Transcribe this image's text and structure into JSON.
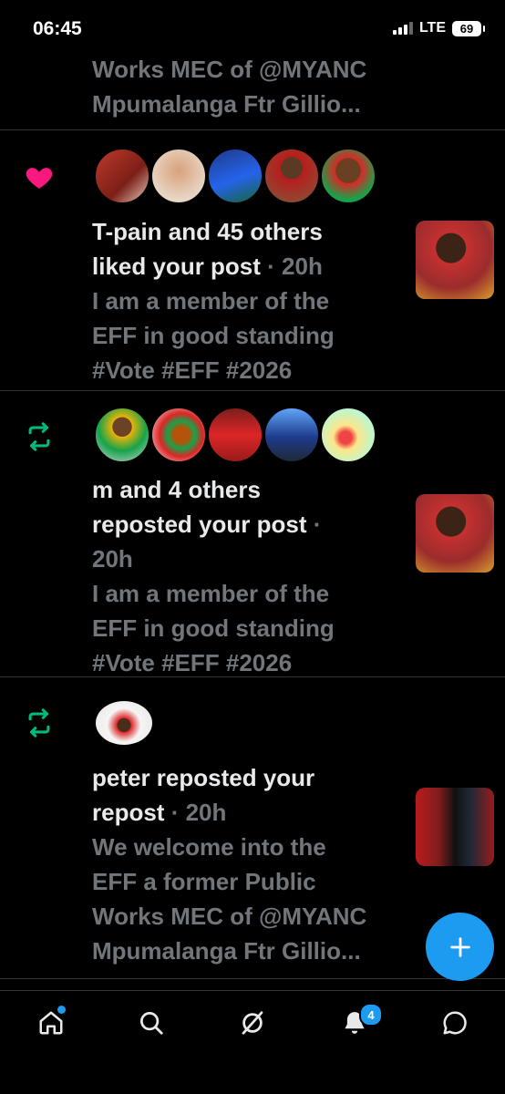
{
  "status_bar": {
    "time": "06:45",
    "network": "LTE",
    "battery": "69"
  },
  "notifications": [
    {
      "type": "partial",
      "lines": [
        "Works MEC of @MYANC",
        "Mpumalanga Ftr Gillio..."
      ]
    },
    {
      "type": "like",
      "icon": "heart-icon",
      "title_line1": "T-pain and 45 others",
      "title_line2": "liked your post",
      "time": "· 20h",
      "post_lines": [
        "I am a member of the",
        "EFF in good standing",
        "#Vote #EFF #2026"
      ]
    },
    {
      "type": "repost",
      "icon": "repost-icon",
      "title_line1": "m and 4 others",
      "title_line2": "reposted your post",
      "time_sep": "·",
      "time": "20h",
      "post_lines": [
        "I am a member of the",
        "EFF in good standing",
        "#Vote #EFF #2026"
      ]
    },
    {
      "type": "repost",
      "icon": "repost-icon",
      "title_line1": "peter reposted your",
      "title_line2": "repost",
      "time": "· 20h",
      "post_lines": [
        "We welcome into the",
        "EFF a former Public",
        "Works MEC of @MYANC",
        "Mpumalanga Ftr Gillio..."
      ]
    }
  ],
  "bottom_nav": {
    "items": [
      "home-icon",
      "search-icon",
      "grok-icon",
      "notifications-icon",
      "messages-icon"
    ],
    "notifications_badge": "4"
  },
  "colors": {
    "accent": "#1d9bf0",
    "like": "#f91880",
    "repost": "#00ba7c",
    "muted": "#71767b"
  }
}
